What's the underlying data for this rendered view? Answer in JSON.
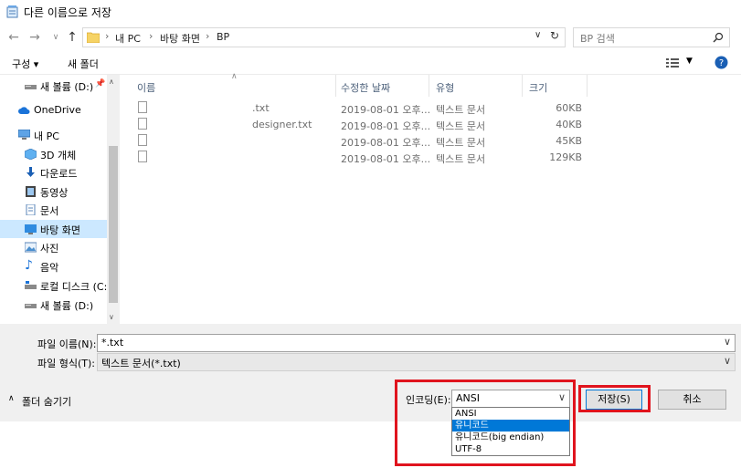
{
  "window": {
    "title": "다른 이름으로 저장",
    "breadcrumbs": [
      "내 PC",
      "바탕 화면",
      "BP"
    ],
    "search_placeholder": "BP 검색"
  },
  "toolbar": {
    "organize_label": "구성 ▾",
    "new_folder_label": "새 폴더"
  },
  "nav_items": [
    {
      "label": "새 볼륨 (D:)",
      "icon": "drive-icon"
    },
    {
      "label": "OneDrive",
      "icon": "cloud-icon"
    },
    {
      "label": "내 PC",
      "icon": "computer-icon"
    },
    {
      "label": "3D 개체",
      "icon": "cube-icon"
    },
    {
      "label": "다운로드",
      "icon": "download-icon"
    },
    {
      "label": "동영상",
      "icon": "video-icon"
    },
    {
      "label": "문서",
      "icon": "document-icon"
    },
    {
      "label": "바탕 화면",
      "icon": "desktop-icon"
    },
    {
      "label": "사진",
      "icon": "picture-icon"
    },
    {
      "label": "음악",
      "icon": "music-icon"
    },
    {
      "label": "로컬 디스크 (C:",
      "icon": "drive-icon"
    },
    {
      "label": "새 볼륨 (D:)",
      "icon": "drive-icon"
    }
  ],
  "columns": {
    "name": "이름",
    "date": "수정한 날짜",
    "type": "유형",
    "size": "크기"
  },
  "files": [
    {
      "name": ".txt",
      "date": "2019-08-01 오후...",
      "type": "텍스트 문서",
      "size": "60KB"
    },
    {
      "name": "designer.txt",
      "date": "2019-08-01 오후...",
      "type": "텍스트 문서",
      "size": "40KB"
    },
    {
      "name": "",
      "date": "2019-08-01 오후...",
      "type": "텍스트 문서",
      "size": "45KB"
    },
    {
      "name": "",
      "date": "2019-08-01 오후...",
      "type": "텍스트 문서",
      "size": "129KB"
    }
  ],
  "form": {
    "filename_label": "파일 이름(N):",
    "filename_value": "*.txt",
    "filetype_label": "파일 형식(T):",
    "filetype_value": "텍스트 문서(*.txt)",
    "hide_folders_label": "폴더 숨기기",
    "encoding_label": "인코딩(E):",
    "encoding_value": "ANSI",
    "save_label": "저장(S)",
    "cancel_label": "취소"
  },
  "encoding_options": [
    "ANSI",
    "유니코드",
    "유니코드(big endian)",
    "UTF-8"
  ],
  "encoding_highlighted": "유니코드",
  "colors": {
    "accent": "#0078d7",
    "annotation_red": "#e0141e",
    "selected_nav": "#cce8ff"
  }
}
